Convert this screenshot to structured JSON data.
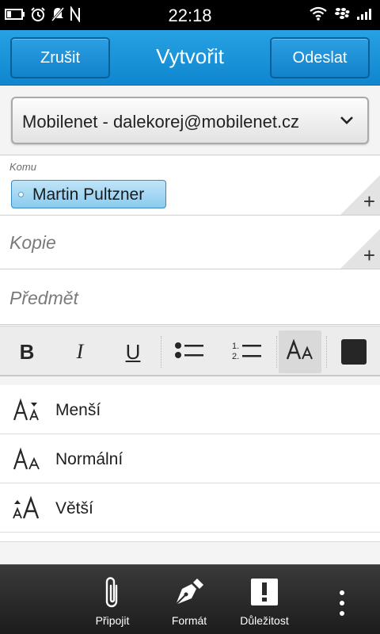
{
  "status_bar": {
    "time": "22:18",
    "left_icons": [
      "battery-icon",
      "alarm-icon",
      "notifications-off-icon",
      "nfc-icon"
    ],
    "right_icons": [
      "wifi-icon",
      "blackberry-icon",
      "signal-icon"
    ]
  },
  "header": {
    "cancel_label": "Zrušit",
    "title": "Vytvořit",
    "send_label": "Odeslat"
  },
  "account": {
    "selected": "Mobilenet - dalekorej@mobilenet.cz"
  },
  "to_field": {
    "label": "Komu",
    "recipients": [
      "Martin Pultzner"
    ]
  },
  "cc_field": {
    "placeholder": "Kopie"
  },
  "subject_field": {
    "placeholder": "Předmět"
  },
  "format_toolbar": {
    "bold": "B",
    "italic": "I",
    "underline": "U",
    "text_color": "#262626"
  },
  "size_options": [
    {
      "label": "Menší",
      "icon": "text-size-smaller-icon"
    },
    {
      "label": "Normální",
      "icon": "text-size-normal-icon"
    },
    {
      "label": "Větší",
      "icon": "text-size-larger-icon"
    }
  ],
  "action_bar": {
    "attach_label": "Připojit",
    "format_label": "Formát",
    "priority_label": "Důležitost"
  },
  "colors": {
    "accent": "#1b93da",
    "action_bar": "#2a2a2a"
  }
}
